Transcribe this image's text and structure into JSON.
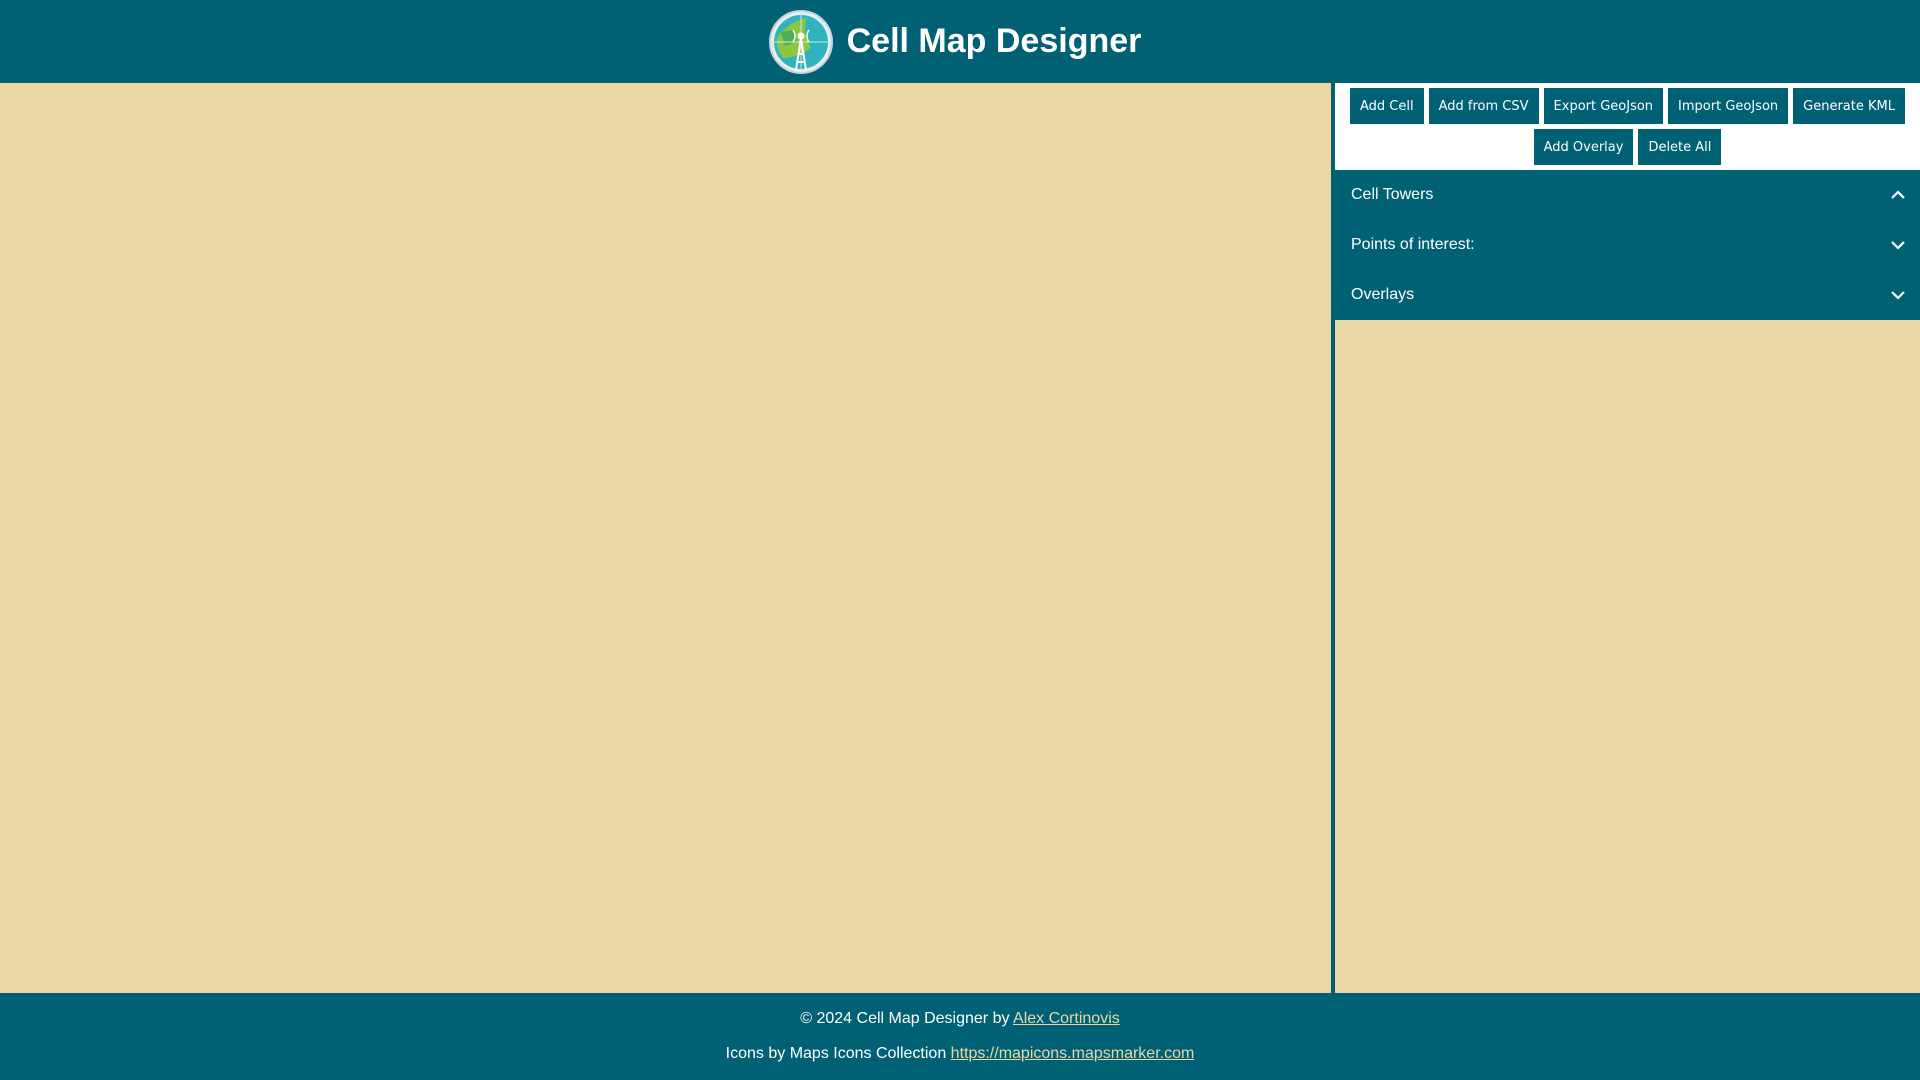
{
  "app": {
    "title": "Cell Map Designer",
    "logo_icon": "cell-tower-globe-icon"
  },
  "colors": {
    "primary": "#006175",
    "background": "#ead7a5",
    "toolbar_bg": "#ffffff",
    "link": "#ead7a5"
  },
  "toolbar": {
    "add_cell": "Add Cell",
    "add_from_csv": "Add from CSV",
    "export_geojson": "Export GeoJson",
    "import_geojson": "Import GeoJson",
    "generate_kml": "Generate KML",
    "add_overlay": "Add Overlay",
    "delete_all": "Delete All"
  },
  "sidebar": {
    "sections": [
      {
        "label": "Cell Towers",
        "expanded": true,
        "icon": "chevron-up-icon"
      },
      {
        "label": "Points of interest:",
        "expanded": false,
        "icon": "chevron-down-icon"
      },
      {
        "label": "Overlays",
        "expanded": false,
        "icon": "chevron-down-icon"
      }
    ]
  },
  "footer": {
    "copyright_prefix": "© 2024 Cell Map Designer by ",
    "author_link": "Alex Cortinovis",
    "icons_prefix": "Icons by Maps Icons Collection ",
    "icons_link": "https://mapicons.mapsmarker.com"
  }
}
